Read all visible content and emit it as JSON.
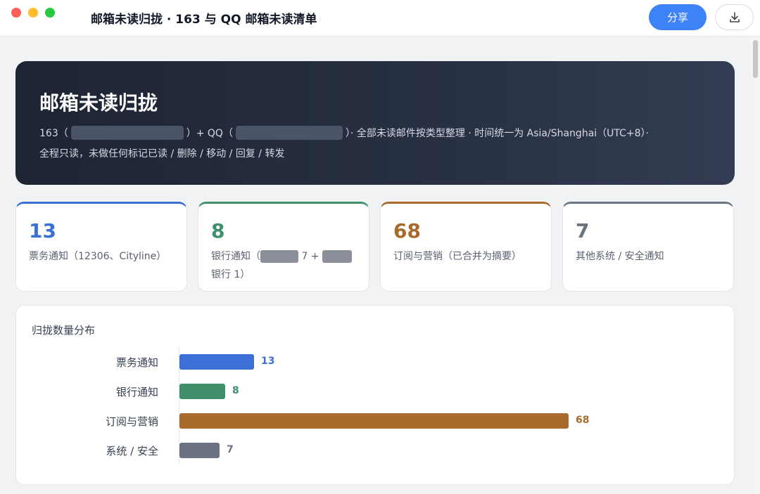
{
  "window": {
    "title": "邮箱未读归拢 · 163 与 QQ 邮箱未读清单",
    "share_label": "分享",
    "download_icon": "download-icon"
  },
  "hero": {
    "title": "邮箱未读归拢",
    "line1_a": "163（",
    "line1_b": "）+ QQ（",
    "line1_c": "）· 全部未读邮件按类型整理 · 时间统一为 Asia/Shanghai（UTC+8）·",
    "line2": "全程只读，未做任何标记已读 / 删除 / 移动 / 回复 / 转发"
  },
  "cards": [
    {
      "value": "13",
      "label": "票务通知（12306、Cityline）",
      "color": "#3c6fd8"
    },
    {
      "value": "8",
      "label_a": "银行通知（",
      "label_b": "7 + ",
      "label_c": "银行 1）",
      "color": "#3f8f6b"
    },
    {
      "value": "68",
      "label": "订阅与营销（已合并为摘要）",
      "color": "#a86b2c"
    },
    {
      "value": "7",
      "label": "其他系统 / 安全通知",
      "color": "#6b7280"
    }
  ],
  "chart_data": {
    "type": "bar",
    "orientation": "horizontal",
    "title": "归拢数量分布",
    "categories": [
      "票务通知",
      "银行通知",
      "订阅与营销",
      "系统 / 安全"
    ],
    "values": [
      13,
      8,
      68,
      7
    ],
    "value_labels": [
      "13",
      "8",
      "68",
      "7"
    ],
    "colors": [
      "#3c6fd8",
      "#3f8f6b",
      "#a86b2c",
      "#6b7280"
    ],
    "xlim": [
      0,
      68
    ],
    "grid": false,
    "legend": "none"
  }
}
